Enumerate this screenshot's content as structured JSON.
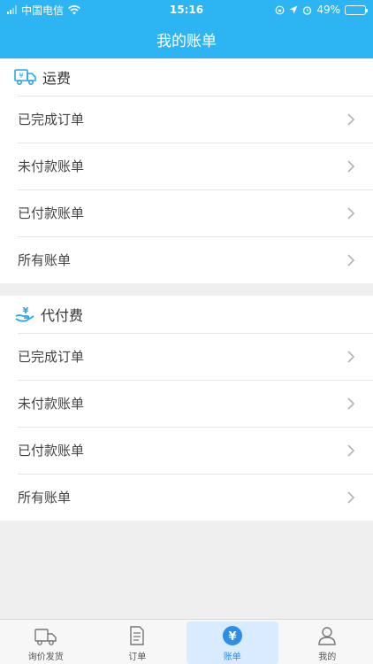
{
  "status": {
    "carrier": "中国电信",
    "time": "15:16",
    "battery": "49%",
    "battery_level": 0.49
  },
  "header": {
    "title": "我的账单"
  },
  "sections": [
    {
      "icon": "delivery-truck-yen-icon",
      "title": "运费",
      "items": [
        {
          "label": "已完成订单"
        },
        {
          "label": "未付款账单"
        },
        {
          "label": "已付款账单"
        },
        {
          "label": "所有账单"
        }
      ]
    },
    {
      "icon": "hand-yen-icon",
      "title": "代付费",
      "items": [
        {
          "label": "已完成订单"
        },
        {
          "label": "未付款账单"
        },
        {
          "label": "已付款账单"
        },
        {
          "label": "所有账单"
        }
      ]
    }
  ],
  "tabbar": [
    {
      "label": "询价发货",
      "icon": "truck-icon",
      "active": false
    },
    {
      "label": "订单",
      "icon": "document-icon",
      "active": false
    },
    {
      "label": "账单",
      "icon": "yen-circle-icon",
      "active": true
    },
    {
      "label": "我的",
      "icon": "person-icon",
      "active": false
    }
  ],
  "colors": {
    "accent": "#2db5f3",
    "active_tab": "#2d8ee8"
  }
}
